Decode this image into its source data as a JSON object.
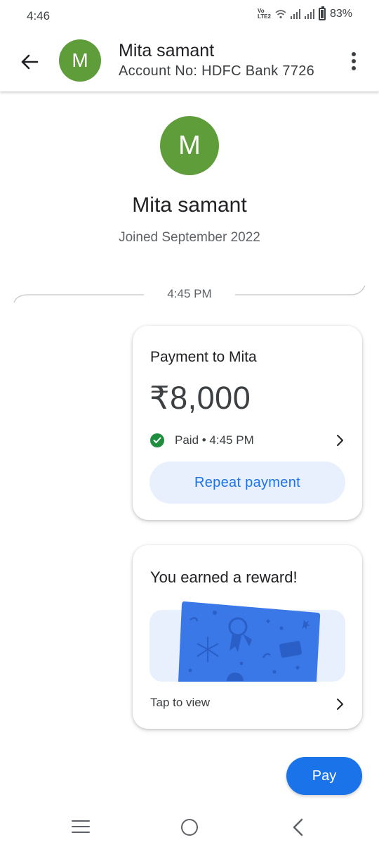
{
  "status_bar": {
    "time": "4:46",
    "network_label": "VoLTE2",
    "battery_percent": "83%"
  },
  "header": {
    "avatar_letter": "M",
    "name": "Mita samant",
    "account": "Account No: HDFC Bank 7726",
    "back_icon": "arrow-left-icon",
    "more_icon": "more-vert-icon"
  },
  "profile": {
    "avatar_letter": "M",
    "name": "Mita samant",
    "joined": "Joined September 2022",
    "avatar_color": "#5f9d3b"
  },
  "timeline": {
    "timestamp": "4:45 PM"
  },
  "payment_card": {
    "title": "Payment to Mita",
    "amount": "₹8,000",
    "status": "Paid • 4:45 PM",
    "status_color": "#1e8e3e",
    "repeat_label": "Repeat payment"
  },
  "reward_card": {
    "title": "You earned a reward!",
    "tap_label": "Tap to view",
    "card_color": "#3b78e7"
  },
  "fab": {
    "pay_label": "Pay",
    "color": "#1a73e8"
  },
  "nav": {
    "recents_icon": "menu-icon",
    "home_icon": "circle-home-icon",
    "back_icon": "chevron-left-icon"
  }
}
